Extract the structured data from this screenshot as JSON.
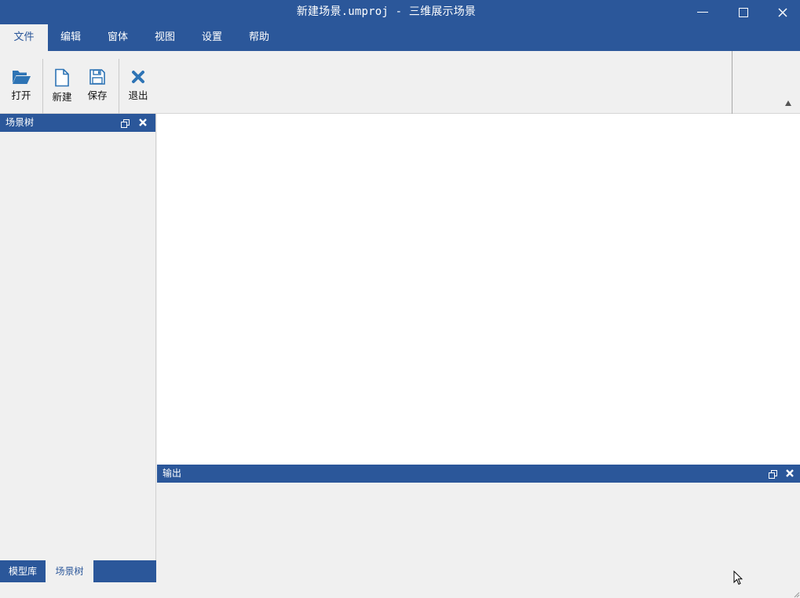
{
  "window": {
    "title": "新建场景.umproj - 三维展示场景",
    "controls": [
      "minimize-icon",
      "maximize-icon",
      "close-icon"
    ]
  },
  "menu": {
    "items": [
      "文件",
      "编辑",
      "窗体",
      "视图",
      "设置",
      "帮助"
    ],
    "active_index": 0
  },
  "ribbon": {
    "buttons": [
      {
        "label": "打开",
        "icon": "folder-open-icon"
      },
      {
        "label": "新建",
        "icon": "new-file-icon"
      },
      {
        "label": "保存",
        "icon": "save-icon"
      },
      {
        "label": "退出",
        "icon": "exit-x-icon"
      }
    ],
    "collapse_icon": "chevron-up-icon"
  },
  "left_panel": {
    "title": "场景树",
    "tabs": [
      "模型库",
      "场景树"
    ],
    "active_tab_index": 1
  },
  "output_panel": {
    "title": "输出"
  },
  "colors": {
    "accent": "#2b579a",
    "ribbon_icon": "#2e74b5",
    "background": "#f0f0f0",
    "canvas": "#ffffff"
  }
}
